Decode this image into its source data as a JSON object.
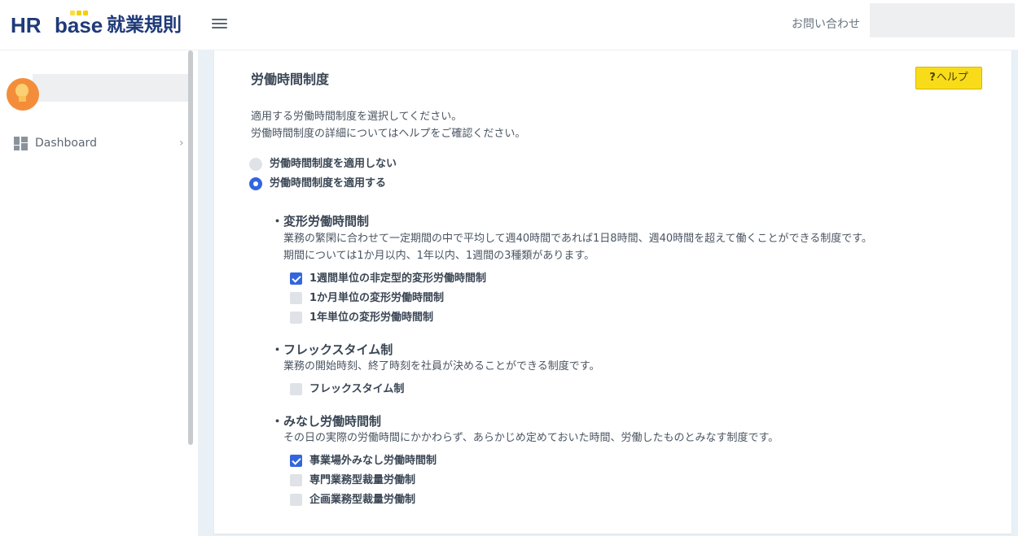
{
  "header": {
    "logo": {
      "hr": "HR",
      "base": "base",
      "rules": "就業規則"
    },
    "contact_label": "お問い合わせ"
  },
  "sidebar": {
    "items": [
      {
        "label": "Dashboard"
      }
    ]
  },
  "main": {
    "title": "労働時間制度",
    "help_label": "ヘルプ",
    "help_mark": "?",
    "description": [
      "適用する労働時間制度を選択してください。",
      "労働時間制度の詳細についてはヘルプをご確認ください。"
    ],
    "options": [
      {
        "label": "労働時間制度を適用しない",
        "selected": false
      },
      {
        "label": "労働時間制度を適用する",
        "selected": true
      }
    ],
    "sections": [
      {
        "title": "・変形労働時間制",
        "description": [
          "業務の繁閑に合わせて一定期間の中で平均して週40時間であれば1日8時間、週40時間を超えて働くことができる制度です。",
          "期間については1か月以内、1年以内、1週間の3種類があります。"
        ],
        "items": [
          {
            "label": "1週間単位の非定型的変形労働時間制",
            "checked": true
          },
          {
            "label": "1か月単位の変形労働時間制",
            "checked": false
          },
          {
            "label": "1年単位の変形労働時間制",
            "checked": false
          }
        ]
      },
      {
        "title": "・フレックスタイム制",
        "description": [
          "業務の開始時刻、終了時刻を社員が決めることができる制度です。"
        ],
        "items": [
          {
            "label": "フレックスタイム制",
            "checked": false
          }
        ]
      },
      {
        "title": "・みなし労働時間制",
        "description": [
          "その日の実際の労働時間にかかわらず、あらかじめ定めておいた時間、労働したものとみなす制度です。"
        ],
        "items": [
          {
            "label": "事業場外みなし労働時間制",
            "checked": true
          },
          {
            "label": "専門業務型裁量労働制",
            "checked": false
          },
          {
            "label": "企画業務型裁量労働制",
            "checked": false
          }
        ]
      }
    ]
  },
  "icons": {
    "menu": "hamburger-icon",
    "avatar": "lightbulb-avatar",
    "dashboard": "dashboard-grid-icon",
    "chevron": "chevron-right-icon"
  },
  "colors": {
    "brand": "#1f3a78",
    "accent": "#3366dd",
    "help_button": "#f8dc1a",
    "avatar": "#f48d3a"
  }
}
